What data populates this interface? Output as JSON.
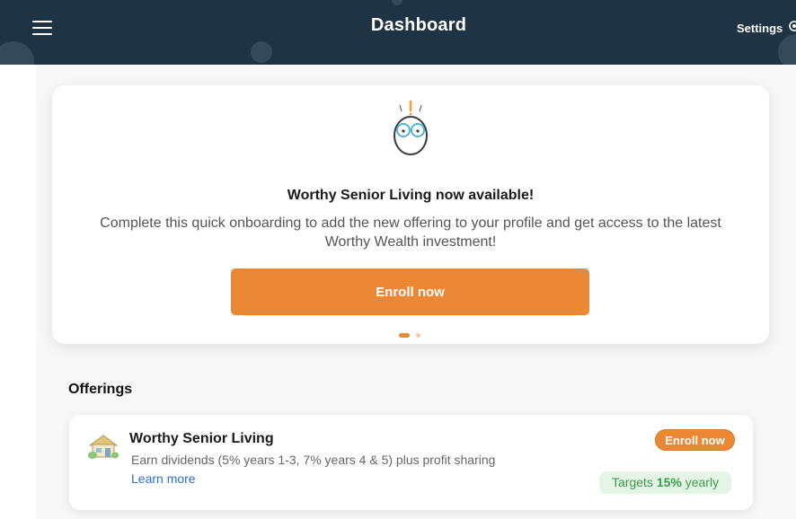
{
  "header": {
    "title": "Dashboard",
    "settings_label": "Settings",
    "menu_icon": "hamburger-menu-icon",
    "settings_icon": "gear-icon",
    "background_color": "#1e3344"
  },
  "banner": {
    "mascot_icon": "owl-with-glasses-icon",
    "title": "Worthy Senior Living now available!",
    "text": "Complete this quick onboarding to add the new offering to your profile and get access to the latest Worthy Wealth investment!",
    "button_label": "Enroll now",
    "carousel_pages": 2,
    "carousel_active_index": 0
  },
  "offerings": {
    "section_title": "Offerings",
    "items": [
      {
        "icon": "house-icon",
        "name": "Worthy Senior Living",
        "description": "Earn dividends (5% years 1-3, 7% years 4 & 5) plus profit sharing",
        "learn_more_label": "Learn more",
        "enroll_label": "Enroll now",
        "target_prefix": "Targets",
        "target_value": "15%",
        "target_suffix": "yearly"
      }
    ]
  },
  "colors": {
    "accent": "#ec8734",
    "link": "#2d6fd1",
    "badge_bg": "#e4f5e6",
    "badge_text": "#3d9a4b"
  }
}
